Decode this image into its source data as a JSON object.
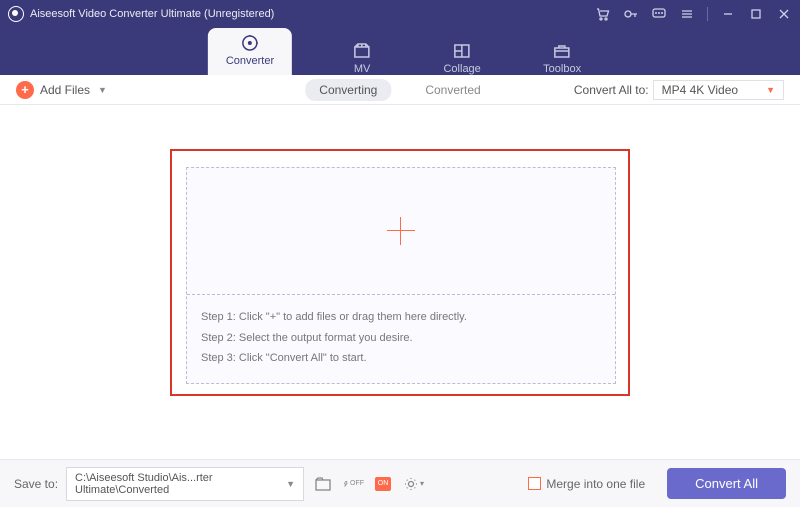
{
  "app": {
    "title": "Aiseesoft Video Converter Ultimate (Unregistered)"
  },
  "tabs": {
    "converter": "Converter",
    "mv": "MV",
    "collage": "Collage",
    "toolbox": "Toolbox"
  },
  "toolbar": {
    "add_files": "Add Files",
    "converting": "Converting",
    "converted": "Converted",
    "convert_all_to": "Convert All to:",
    "format": "MP4 4K Video"
  },
  "steps": {
    "s1": "Step 1: Click \"+\" to add files or drag them here directly.",
    "s2": "Step 2: Select the output format you desire.",
    "s3": "Step 3: Click \"Convert All\" to start."
  },
  "footer": {
    "save_to": "Save to:",
    "path": "C:\\Aiseesoft Studio\\Ais...rter Ultimate\\Converted",
    "merge": "Merge into one file",
    "convert_all": "Convert All",
    "gpu": "ON"
  }
}
